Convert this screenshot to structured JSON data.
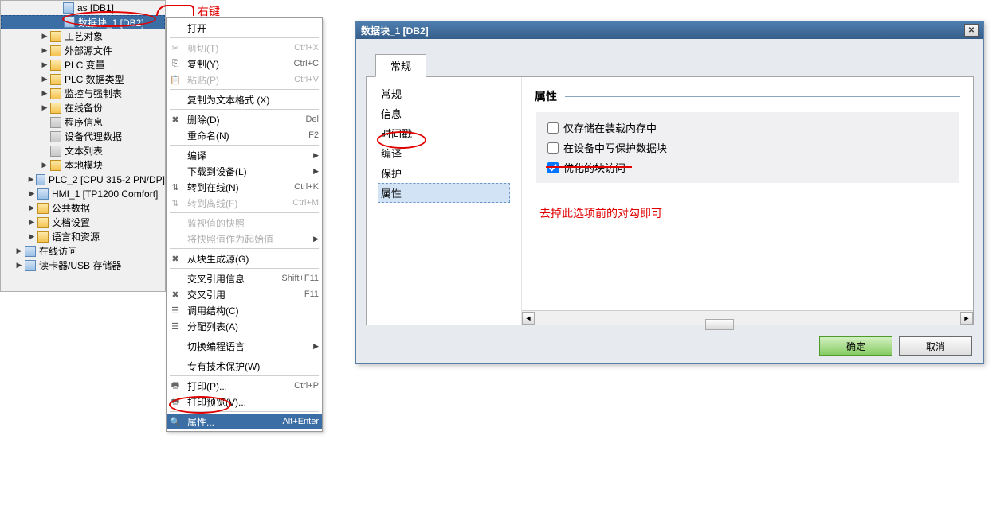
{
  "annotations": {
    "right_click": "右键",
    "uncheck_note": "去掉此选项前的对勾即可"
  },
  "tree": {
    "items": [
      {
        "label": "as [DB1]",
        "indent": 4,
        "icon": "device",
        "exp": "",
        "sel": false
      },
      {
        "label": "数据块_1 [DB2]",
        "indent": 4,
        "icon": "device",
        "exp": "",
        "sel": true
      },
      {
        "label": "工艺对象",
        "indent": 3,
        "icon": "folder",
        "exp": "▶"
      },
      {
        "label": "外部源文件",
        "indent": 3,
        "icon": "folder",
        "exp": "▶"
      },
      {
        "label": "PLC 变量",
        "indent": 3,
        "icon": "folder",
        "exp": "▶"
      },
      {
        "label": "PLC 数据类型",
        "indent": 3,
        "icon": "folder",
        "exp": "▶"
      },
      {
        "label": "监控与强制表",
        "indent": 3,
        "icon": "folder",
        "exp": "▶"
      },
      {
        "label": "在线备份",
        "indent": 3,
        "icon": "folder",
        "exp": "▶"
      },
      {
        "label": "程序信息",
        "indent": 3,
        "icon": "gray",
        "exp": ""
      },
      {
        "label": "设备代理数据",
        "indent": 3,
        "icon": "gray",
        "exp": ""
      },
      {
        "label": "文本列表",
        "indent": 3,
        "icon": "gray",
        "exp": ""
      },
      {
        "label": "本地模块",
        "indent": 3,
        "icon": "folder",
        "exp": "▶"
      },
      {
        "label": "PLC_2 [CPU 315-2 PN/DP]",
        "indent": 2,
        "icon": "device",
        "exp": "▶"
      },
      {
        "label": "HMI_1 [TP1200 Comfort]",
        "indent": 2,
        "icon": "device",
        "exp": "▶"
      },
      {
        "label": "公共数据",
        "indent": 2,
        "icon": "folder",
        "exp": "▶"
      },
      {
        "label": "文档设置",
        "indent": 2,
        "icon": "folder",
        "exp": "▶"
      },
      {
        "label": "语言和资源",
        "indent": 2,
        "icon": "folder",
        "exp": "▶"
      },
      {
        "label": "在线访问",
        "indent": 1,
        "icon": "device",
        "exp": "▶"
      },
      {
        "label": "读卡器/USB 存储器",
        "indent": 1,
        "icon": "device",
        "exp": "▶"
      }
    ]
  },
  "menu": {
    "items": [
      {
        "label": "打开",
        "shortcut": "",
        "icon": "",
        "type": "item"
      },
      {
        "type": "sep"
      },
      {
        "label": "剪切(T)",
        "shortcut": "Ctrl+X",
        "icon": "✂",
        "type": "item",
        "disabled": true
      },
      {
        "label": "复制(Y)",
        "shortcut": "Ctrl+C",
        "icon": "⎘",
        "type": "item"
      },
      {
        "label": "粘贴(P)",
        "shortcut": "Ctrl+V",
        "icon": "📋",
        "type": "item",
        "disabled": true
      },
      {
        "type": "sep"
      },
      {
        "label": "复制为文本格式 (X)",
        "shortcut": "",
        "icon": "",
        "type": "item"
      },
      {
        "type": "sep"
      },
      {
        "label": "删除(D)",
        "shortcut": "Del",
        "icon": "✖",
        "type": "item"
      },
      {
        "label": "重命名(N)",
        "shortcut": "F2",
        "icon": "",
        "type": "item"
      },
      {
        "type": "sep"
      },
      {
        "label": "编译",
        "shortcut": "",
        "icon": "",
        "type": "sub"
      },
      {
        "label": "下载到设备(L)",
        "shortcut": "",
        "icon": "",
        "type": "sub"
      },
      {
        "label": "转到在线(N)",
        "shortcut": "Ctrl+K",
        "icon": "⇅",
        "type": "item"
      },
      {
        "label": "转到离线(F)",
        "shortcut": "Ctrl+M",
        "icon": "⇅",
        "type": "item",
        "disabled": true
      },
      {
        "type": "sep"
      },
      {
        "label": "监视值的快照",
        "shortcut": "",
        "icon": "",
        "type": "item",
        "disabled": true
      },
      {
        "label": "将快照值作为起始值",
        "shortcut": "",
        "icon": "",
        "type": "sub",
        "disabled": true
      },
      {
        "type": "sep"
      },
      {
        "label": "从块生成源(G)",
        "shortcut": "",
        "icon": "✖",
        "type": "item"
      },
      {
        "type": "sep"
      },
      {
        "label": "交叉引用信息",
        "shortcut": "Shift+F11",
        "icon": "",
        "type": "item"
      },
      {
        "label": "交叉引用",
        "shortcut": "F11",
        "icon": "✖",
        "type": "item"
      },
      {
        "label": "调用结构(C)",
        "shortcut": "",
        "icon": "☰",
        "type": "item"
      },
      {
        "label": "分配列表(A)",
        "shortcut": "",
        "icon": "☰",
        "type": "item"
      },
      {
        "type": "sep"
      },
      {
        "label": "切换编程语言",
        "shortcut": "",
        "icon": "",
        "type": "sub"
      },
      {
        "type": "sep"
      },
      {
        "label": "专有技术保护(W)",
        "shortcut": "",
        "icon": "",
        "type": "item"
      },
      {
        "type": "sep"
      },
      {
        "label": "打印(P)...",
        "shortcut": "Ctrl+P",
        "icon": "🖶",
        "type": "item"
      },
      {
        "label": "打印预览(V)...",
        "shortcut": "",
        "icon": "🖶",
        "type": "item"
      },
      {
        "type": "sep"
      },
      {
        "label": "属性...",
        "shortcut": "Alt+Enter",
        "icon": "🔍",
        "type": "item",
        "highlight": true
      }
    ]
  },
  "dialog": {
    "title": "数据块_1 [DB2]",
    "tab": "常规",
    "left_items": [
      "常规",
      "信息",
      "时间戳",
      "编译",
      "保护",
      "属性"
    ],
    "left_selected_index": 5,
    "section": "属性",
    "checkboxes": [
      {
        "label": "仅存储在装载内存中",
        "checked": false
      },
      {
        "label": "在设备中写保护数据块",
        "checked": false
      },
      {
        "label": "优化的块访问",
        "checked": true
      }
    ],
    "ok": "确定",
    "cancel": "取消"
  }
}
